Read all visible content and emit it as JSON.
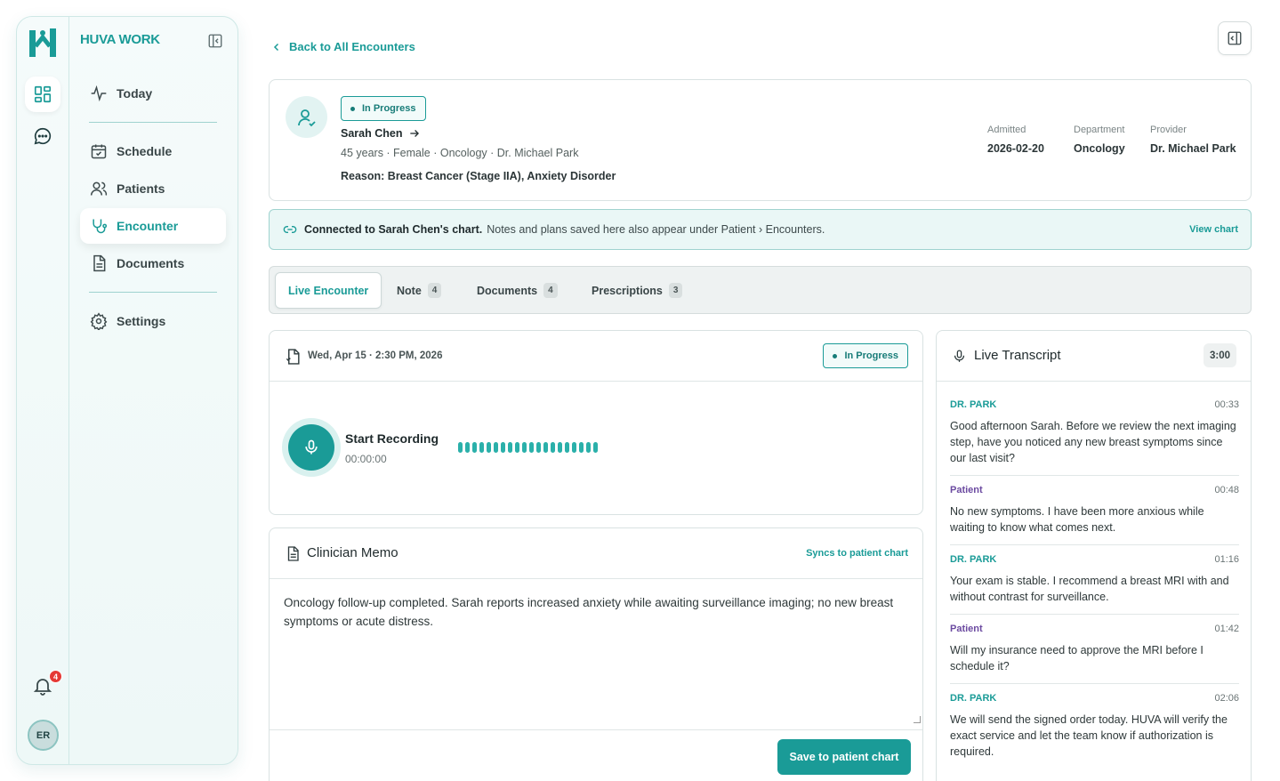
{
  "app": {
    "brand": "HUVA WORK",
    "accent": "#1a9b97"
  },
  "rail": {
    "notification_count": "4",
    "avatar_initials": "ER"
  },
  "nav": {
    "today": "Today",
    "schedule": "Schedule",
    "patients": "Patients",
    "encounter": "Encounter",
    "documents": "Documents",
    "settings": "Settings"
  },
  "header": {
    "back_label": "Back to All Encounters"
  },
  "patient": {
    "status": "In Progress",
    "name": "Sarah Chen",
    "summary": "45 years · Female · Oncology · Dr. Michael Park",
    "reason": "Reason: Breast Cancer (Stage IIA), Anxiety Disorder",
    "meta": [
      {
        "label": "Admitted",
        "value": "2026-02-20"
      },
      {
        "label": "Department",
        "value": "Oncology"
      },
      {
        "label": "Provider",
        "value": "Dr. Michael Park"
      }
    ]
  },
  "banner": {
    "bold": "Connected to Sarah Chen's chart.",
    "text": "Notes and plans saved here also appear under Patient › Encounters.",
    "link": "View chart"
  },
  "tabs": [
    {
      "label": "Live Encounter",
      "count": ""
    },
    {
      "label": "Note",
      "count": "4"
    },
    {
      "label": "Documents",
      "count": "4"
    },
    {
      "label": "Prescriptions",
      "count": "3"
    }
  ],
  "encounter": {
    "date": "Wed, Apr 15 · 2:30 PM, 2026",
    "status": "In Progress",
    "record_label": "Start Recording",
    "record_time": "00:00:00"
  },
  "memo": {
    "title": "Clinician Memo",
    "sync_label": "Syncs to patient chart",
    "text": "Oncology follow-up completed. Sarah reports increased anxiety while awaiting surveillance imaging; no new breast symptoms or acute distress.",
    "save_label": "Save to patient chart"
  },
  "transcript": {
    "title": "Live Transcript",
    "timer": "3:00",
    "entries": [
      {
        "speaker": "DR. PARK",
        "time": "00:33",
        "text": "Good afternoon Sarah. Before we review the next imaging step, have you noticed any new breast symptoms since our last visit?"
      },
      {
        "speaker": "Patient",
        "time": "00:48",
        "text": "No new symptoms. I have been more anxious while waiting to know what comes next."
      },
      {
        "speaker": "DR. PARK",
        "time": "01:16",
        "text": "Your exam is stable. I recommend a breast MRI with and without contrast for surveillance."
      },
      {
        "speaker": "Patient",
        "time": "01:42",
        "text": "Will my insurance need to approve the MRI before I schedule it?"
      },
      {
        "speaker": "DR. PARK",
        "time": "02:06",
        "text": "We will send the signed order today. HUVA will verify the exact service and let the team know if authorization is required."
      }
    ]
  }
}
